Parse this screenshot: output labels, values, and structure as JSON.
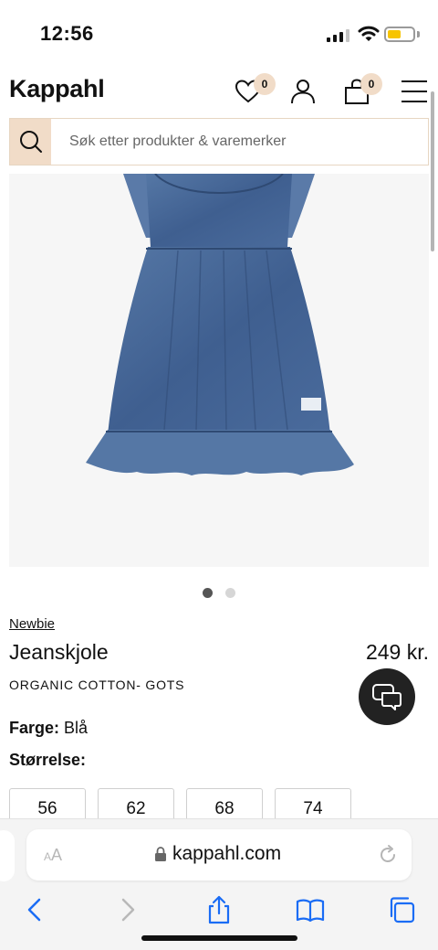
{
  "status_bar": {
    "time": "12:56",
    "battery_color": "#f7c400"
  },
  "header": {
    "logo": "Kappahl",
    "wishlist_count": "0",
    "cart_count": "0",
    "badge_color": "#f1dcc8",
    "icons": [
      "heart-icon",
      "user-icon",
      "shopping-bag-icon",
      "menu-icon"
    ]
  },
  "search": {
    "placeholder": "Søk etter produkter & varemerker",
    "icon": "search-icon",
    "button_color": "#f1dcc8"
  },
  "gallery": {
    "image": "denim-dress",
    "dot_active_color": "#555555",
    "dot_inactive_color": "#d6d6d6",
    "total_images": 2,
    "active_index": 1
  },
  "product": {
    "brand": "Newbie",
    "title": "Jeanskjole",
    "price": "249 kr.",
    "subtitle": "ORGANIC COTTON- GOTS",
    "color_label": "Farge:",
    "color_value": "Blå",
    "size_label": "Størrelse:",
    "sizes": [
      "56",
      "62",
      "68",
      "74"
    ]
  },
  "chat": {
    "icon": "chat-icon",
    "color": "#222222"
  },
  "safari": {
    "aa_small": "A",
    "aa_large": "A",
    "url": "kappahl.com",
    "accent": "#1a6cf5",
    "toolbar": [
      "back-icon",
      "forward-icon",
      "share-icon",
      "bookmarks-icon",
      "tabs-icon"
    ]
  }
}
